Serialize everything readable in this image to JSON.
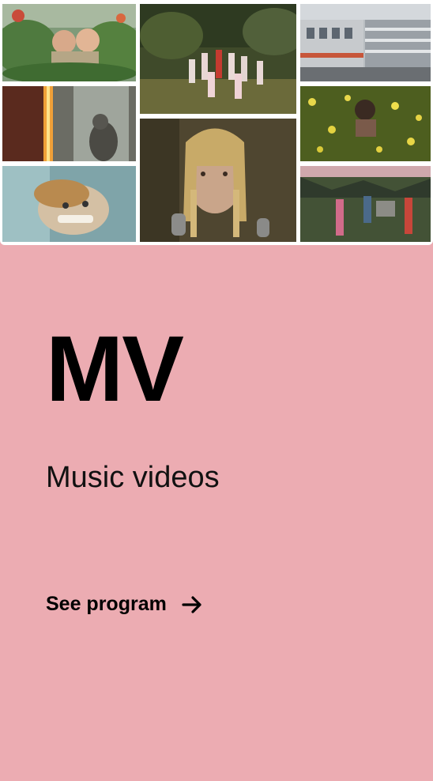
{
  "section": {
    "title": "MV",
    "subtitle": "Music videos",
    "cta_label": "See program",
    "cta_icon": "arrow-right-icon",
    "background_color": "#ecacb2"
  },
  "thumbnails": [
    {
      "name": "thumb-couple-jungle"
    },
    {
      "name": "thumb-burning-window"
    },
    {
      "name": "thumb-smiling-face"
    },
    {
      "name": "thumb-forest-circle"
    },
    {
      "name": "thumb-singer-microphone"
    },
    {
      "name": "thumb-building-glitch"
    },
    {
      "name": "thumb-yellow-flowers"
    },
    {
      "name": "thumb-mountain-dancers"
    }
  ]
}
